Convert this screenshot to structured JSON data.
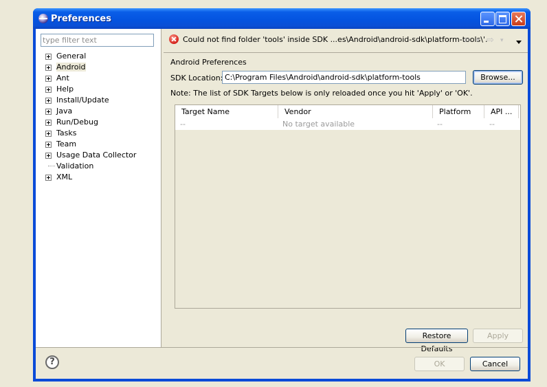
{
  "window": {
    "title": "Preferences"
  },
  "filter": {
    "placeholder": "type filter text"
  },
  "tree": [
    {
      "label": "General",
      "expandable": true
    },
    {
      "label": "Android",
      "expandable": true,
      "selected": true
    },
    {
      "label": "Ant",
      "expandable": true
    },
    {
      "label": "Help",
      "expandable": true
    },
    {
      "label": "Install/Update",
      "expandable": true
    },
    {
      "label": "Java",
      "expandable": true
    },
    {
      "label": "Run/Debug",
      "expandable": true
    },
    {
      "label": "Tasks",
      "expandable": true
    },
    {
      "label": "Team",
      "expandable": true
    },
    {
      "label": "Usage Data Collector",
      "expandable": true
    },
    {
      "label": "Validation",
      "expandable": false
    },
    {
      "label": "XML",
      "expandable": true
    }
  ],
  "message": {
    "error": "Could not find folder 'tools' inside SDK ...es\\Android\\android-sdk\\platform-tools\\'."
  },
  "nav": {
    "back": "⇦",
    "back_drop": "▾",
    "forward": "⇨",
    "forward_drop": "▾"
  },
  "page": {
    "title": "Android Preferences",
    "sdk_label": "SDK Location:",
    "sdk_value": "C:\\Program Files\\Android\\android-sdk\\platform-tools",
    "browse": "Browse...",
    "note": "Note: The list of SDK Targets below is only reloaded once you hit 'Apply' or 'OK'."
  },
  "table": {
    "columns": [
      "Target Name",
      "Vendor",
      "Platform",
      "API ..."
    ],
    "rows": [
      [
        "--",
        "No target available",
        "--",
        "--"
      ]
    ]
  },
  "buttons": {
    "restore": "Restore Defaults",
    "apply": "Apply",
    "ok": "OK",
    "cancel": "Cancel",
    "help": "?"
  },
  "colors": {
    "title_bar": "#0a5ee8",
    "error": "#d3201a",
    "background": "#ece9d8"
  }
}
